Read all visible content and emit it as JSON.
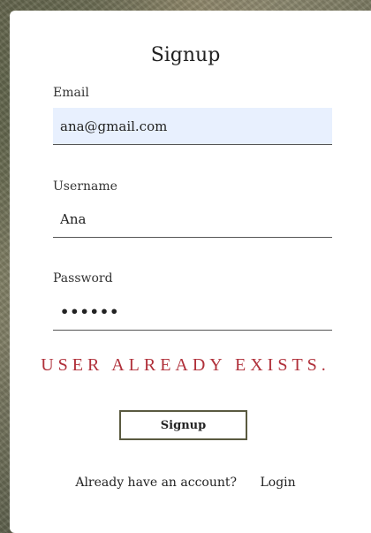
{
  "form": {
    "title": "Signup",
    "email": {
      "label": "Email",
      "value": "ana@gmail.com"
    },
    "username": {
      "label": "Username",
      "value": "Ana"
    },
    "password": {
      "label": "Password",
      "value": "••••••"
    },
    "error": "USER ALREADY EXISTS.",
    "submit_label": "Signup",
    "footer_text": "Already have an account?",
    "login_link": "Login"
  },
  "colors": {
    "error": "#b0303a",
    "button_border": "#5a5a40",
    "autofill_bg": "#e8f0fe"
  }
}
